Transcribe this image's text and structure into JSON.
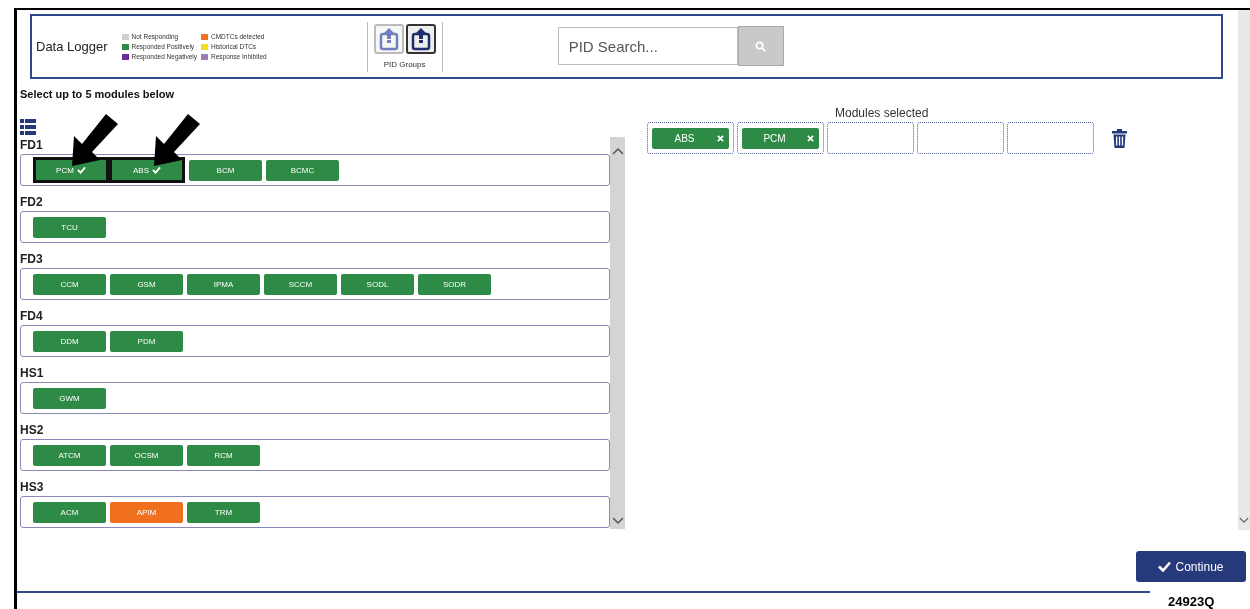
{
  "header": {
    "title": "Data Logger",
    "legend": [
      {
        "label": "Not Responding",
        "color": "#d0d0d0"
      },
      {
        "label": "Responded Positively",
        "color": "#2e8b45"
      },
      {
        "label": "Responded Negatively",
        "color": "#6a2ea0"
      },
      {
        "label": "CMDTCs detected",
        "color": "#f07020"
      },
      {
        "label": "Historical DTCs",
        "color": "#f0e020"
      },
      {
        "label": "Response Inhibited",
        "color": "#9a7fb0"
      }
    ],
    "pid_groups": {
      "label": "PID Groups",
      "buttons": [
        {
          "selected": false
        },
        {
          "selected": true
        }
      ]
    },
    "search": {
      "placeholder": "PID Search..."
    }
  },
  "instruction": "Select up to 5 modules below",
  "groups": [
    {
      "name": "FD1",
      "modules": [
        {
          "label": "PCM",
          "color": "#2e8b45",
          "selected": true
        },
        {
          "label": "ABS",
          "color": "#2e8b45",
          "selected": true
        },
        {
          "label": "BCM",
          "color": "#2e8b45",
          "selected": false
        },
        {
          "label": "BCMC",
          "color": "#2e8b45",
          "selected": false
        }
      ]
    },
    {
      "name": "FD2",
      "modules": [
        {
          "label": "TCU",
          "color": "#2e8b45",
          "selected": false
        }
      ]
    },
    {
      "name": "FD3",
      "modules": [
        {
          "label": "CCM",
          "color": "#2e8b45",
          "selected": false
        },
        {
          "label": "GSM",
          "color": "#2e8b45",
          "selected": false
        },
        {
          "label": "IPMA",
          "color": "#2e8b45",
          "selected": false
        },
        {
          "label": "SCCM",
          "color": "#2e8b45",
          "selected": false
        },
        {
          "label": "SODL",
          "color": "#2e8b45",
          "selected": false
        },
        {
          "label": "SODR",
          "color": "#2e8b45",
          "selected": false
        }
      ]
    },
    {
      "name": "FD4",
      "modules": [
        {
          "label": "DDM",
          "color": "#2e8b45",
          "selected": false
        },
        {
          "label": "PDM",
          "color": "#2e8b45",
          "selected": false
        }
      ]
    },
    {
      "name": "HS1",
      "modules": [
        {
          "label": "GWM",
          "color": "#2e8b45",
          "selected": false
        }
      ]
    },
    {
      "name": "HS2",
      "modules": [
        {
          "label": "ATCM",
          "color": "#2e8b45",
          "selected": false
        },
        {
          "label": "OCSM",
          "color": "#2e8b45",
          "selected": false
        },
        {
          "label": "RCM",
          "color": "#2e8b45",
          "selected": false
        }
      ]
    },
    {
      "name": "HS3",
      "modules": [
        {
          "label": "ACM",
          "color": "#2e8b45",
          "selected": false
        },
        {
          "label": "APIM",
          "color": "#f07020",
          "selected": false
        },
        {
          "label": "TRM",
          "color": "#2e8b45",
          "selected": false
        }
      ]
    }
  ],
  "selected_panel": {
    "title": "Modules selected",
    "slots": [
      {
        "kind": "filled",
        "label": "ABS"
      },
      {
        "kind": "filled",
        "label": "PCM"
      },
      {
        "kind": "empty"
      },
      {
        "kind": "empty"
      },
      {
        "kind": "empty"
      }
    ]
  },
  "continue_button": "Continue",
  "figure_code": "24923Q"
}
